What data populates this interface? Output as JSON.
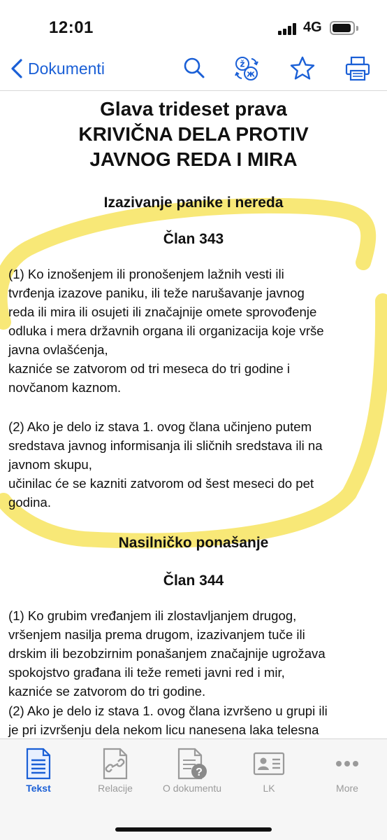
{
  "status_bar": {
    "time": "12:01",
    "network": "4G"
  },
  "nav": {
    "back_label": "Dokumenti"
  },
  "document": {
    "chapter_lines": [
      "Glava trideset prava",
      "KRIVIČNA DELA PROTIV",
      "JAVNOG REDA I MIRA"
    ],
    "sections": [
      {
        "title": "Izazivanje panike i nereda",
        "article": "Član 343",
        "paragraphs": [
          "(1) Ko iznošenjem ili pronošenjem lažnih vesti ili\ntvrđenja izazove paniku, ili teže narušavanje javnog\nreda ili mira ili osujeti ili značajnije omete sprovođenje\nodluka i mera državnih organa ili organizacija koje vrše\njavna ovlašćenja,\nkazniće se zatvorom od tri meseca do tri godine i\nnovčanom kaznom.",
          "(2) Ako je delo iz stava 1. ovog člana učinjeno putem\nsredstava javnog informisanja ili sličnih sredstava ili na\njavnom skupu,\nučinilac će se kazniti zatvorom od šest meseci do pet\ngodina."
        ]
      },
      {
        "title": "Nasilničko ponašanje",
        "article": "Član 344",
        "paragraphs": [
          "(1) Ko grubim vređanjem ili zlostavljanjem drugog,\nvršenjem nasilja prema drugom, izazivanjem tuče ili\ndrskim ili bezobzirnim ponašanjem značajnije ugrožava\nspokojstvo građana ili teže remeti javni red i mir,\nkazniće se zatvorom do tri godine.",
          "(2) Ako je delo iz stava 1. ovog člana izvršeno u grupi ili\nje pri izvršenju dela nekom licu nanesena laka telesna"
        ]
      }
    ]
  },
  "tabs": [
    {
      "label": "Tekst",
      "icon": "document-icon",
      "active": true
    },
    {
      "label": "Relacije",
      "icon": "link-document-icon",
      "active": false
    },
    {
      "label": "O dokumentu",
      "icon": "document-info-icon",
      "active": false
    },
    {
      "label": "LK",
      "icon": "id-card-icon",
      "active": false
    },
    {
      "label": "More",
      "icon": "more-icon",
      "active": false
    }
  ],
  "colors": {
    "accent": "#1a5fd6",
    "highlight": "#f5e04a",
    "inactive": "#9a9a9a"
  }
}
